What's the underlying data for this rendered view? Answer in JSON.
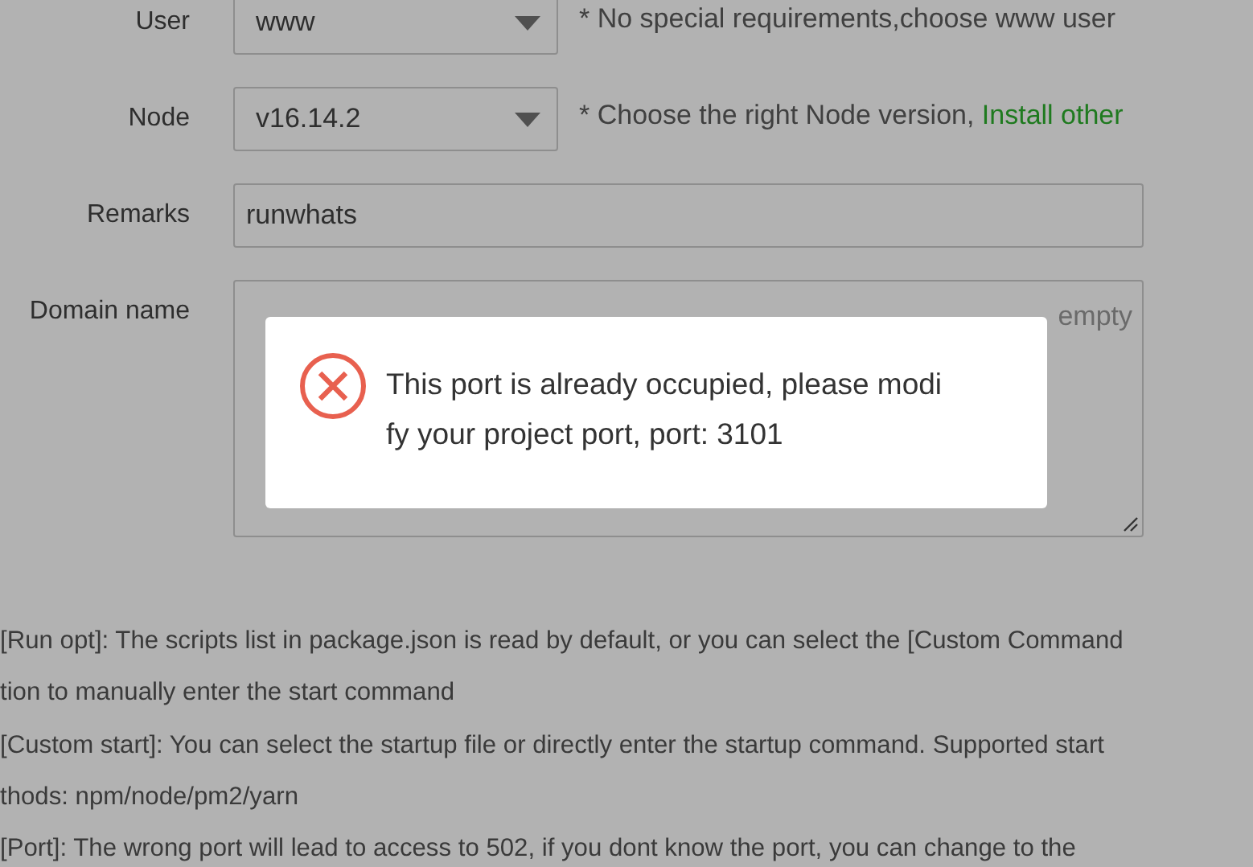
{
  "form": {
    "rows": [
      {
        "kind": "select",
        "label": "User",
        "value": "www",
        "hint": "* No special requirements,choose www user"
      },
      {
        "kind": "select",
        "label": "Node",
        "value": "v16.14.2",
        "hint": "* Choose the right Node version, ",
        "link": "Install other"
      },
      {
        "kind": "input",
        "label": "Remarks",
        "value": "runwhats"
      },
      {
        "kind": "textarea",
        "label": "Domain name",
        "placeholder": "empty"
      }
    ]
  },
  "help_lines": [
    "[Run opt]: The scripts list in package.json is read by default, or you can select the [Custom Command",
    "tion to manually enter the start command",
    "[Custom start]: You can select the startup file or directly enter the startup command. Supported start",
    "thods: npm/node/pm2/yarn",
    "[Port]:  The wrong port will lead to access to 502, if you dont know the port, you can change to the"
  ],
  "toast": {
    "kind": "error",
    "lines": [
      "This port is already occupied, please modi",
      "fy your project port, port: 3101"
    ]
  }
}
